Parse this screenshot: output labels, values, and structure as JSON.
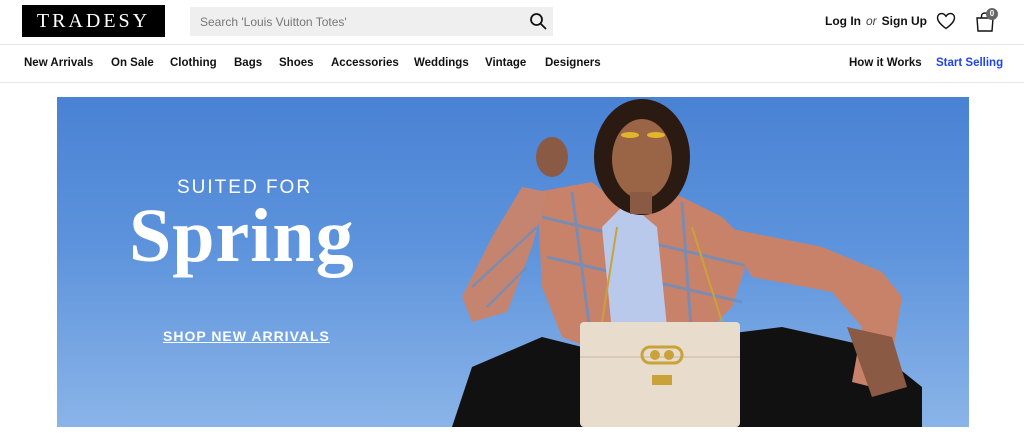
{
  "header": {
    "logo_text": "TRADESY",
    "search_placeholder": "Search 'Louis Vuitton Totes'",
    "login_label": "Log In",
    "or_label": "or",
    "signup_label": "Sign Up",
    "cart_count": "0"
  },
  "nav": {
    "items": [
      "New Arrivals",
      "On Sale",
      "Clothing",
      "Bags",
      "Shoes",
      "Accessories",
      "Weddings",
      "Vintage",
      "Designers"
    ],
    "how_it_works": "How it Works",
    "start_selling": "Start Selling"
  },
  "hero": {
    "kicker": "SUITED FOR",
    "title": "Spring",
    "cta": "SHOP NEW ARRIVALS"
  },
  "colors": {
    "accent": "#1f45e6",
    "hero_blue": "#5d93dc",
    "logo_bg": "#000000"
  },
  "icons": [
    "search-icon",
    "heart-icon",
    "shopping-bag-icon"
  ]
}
